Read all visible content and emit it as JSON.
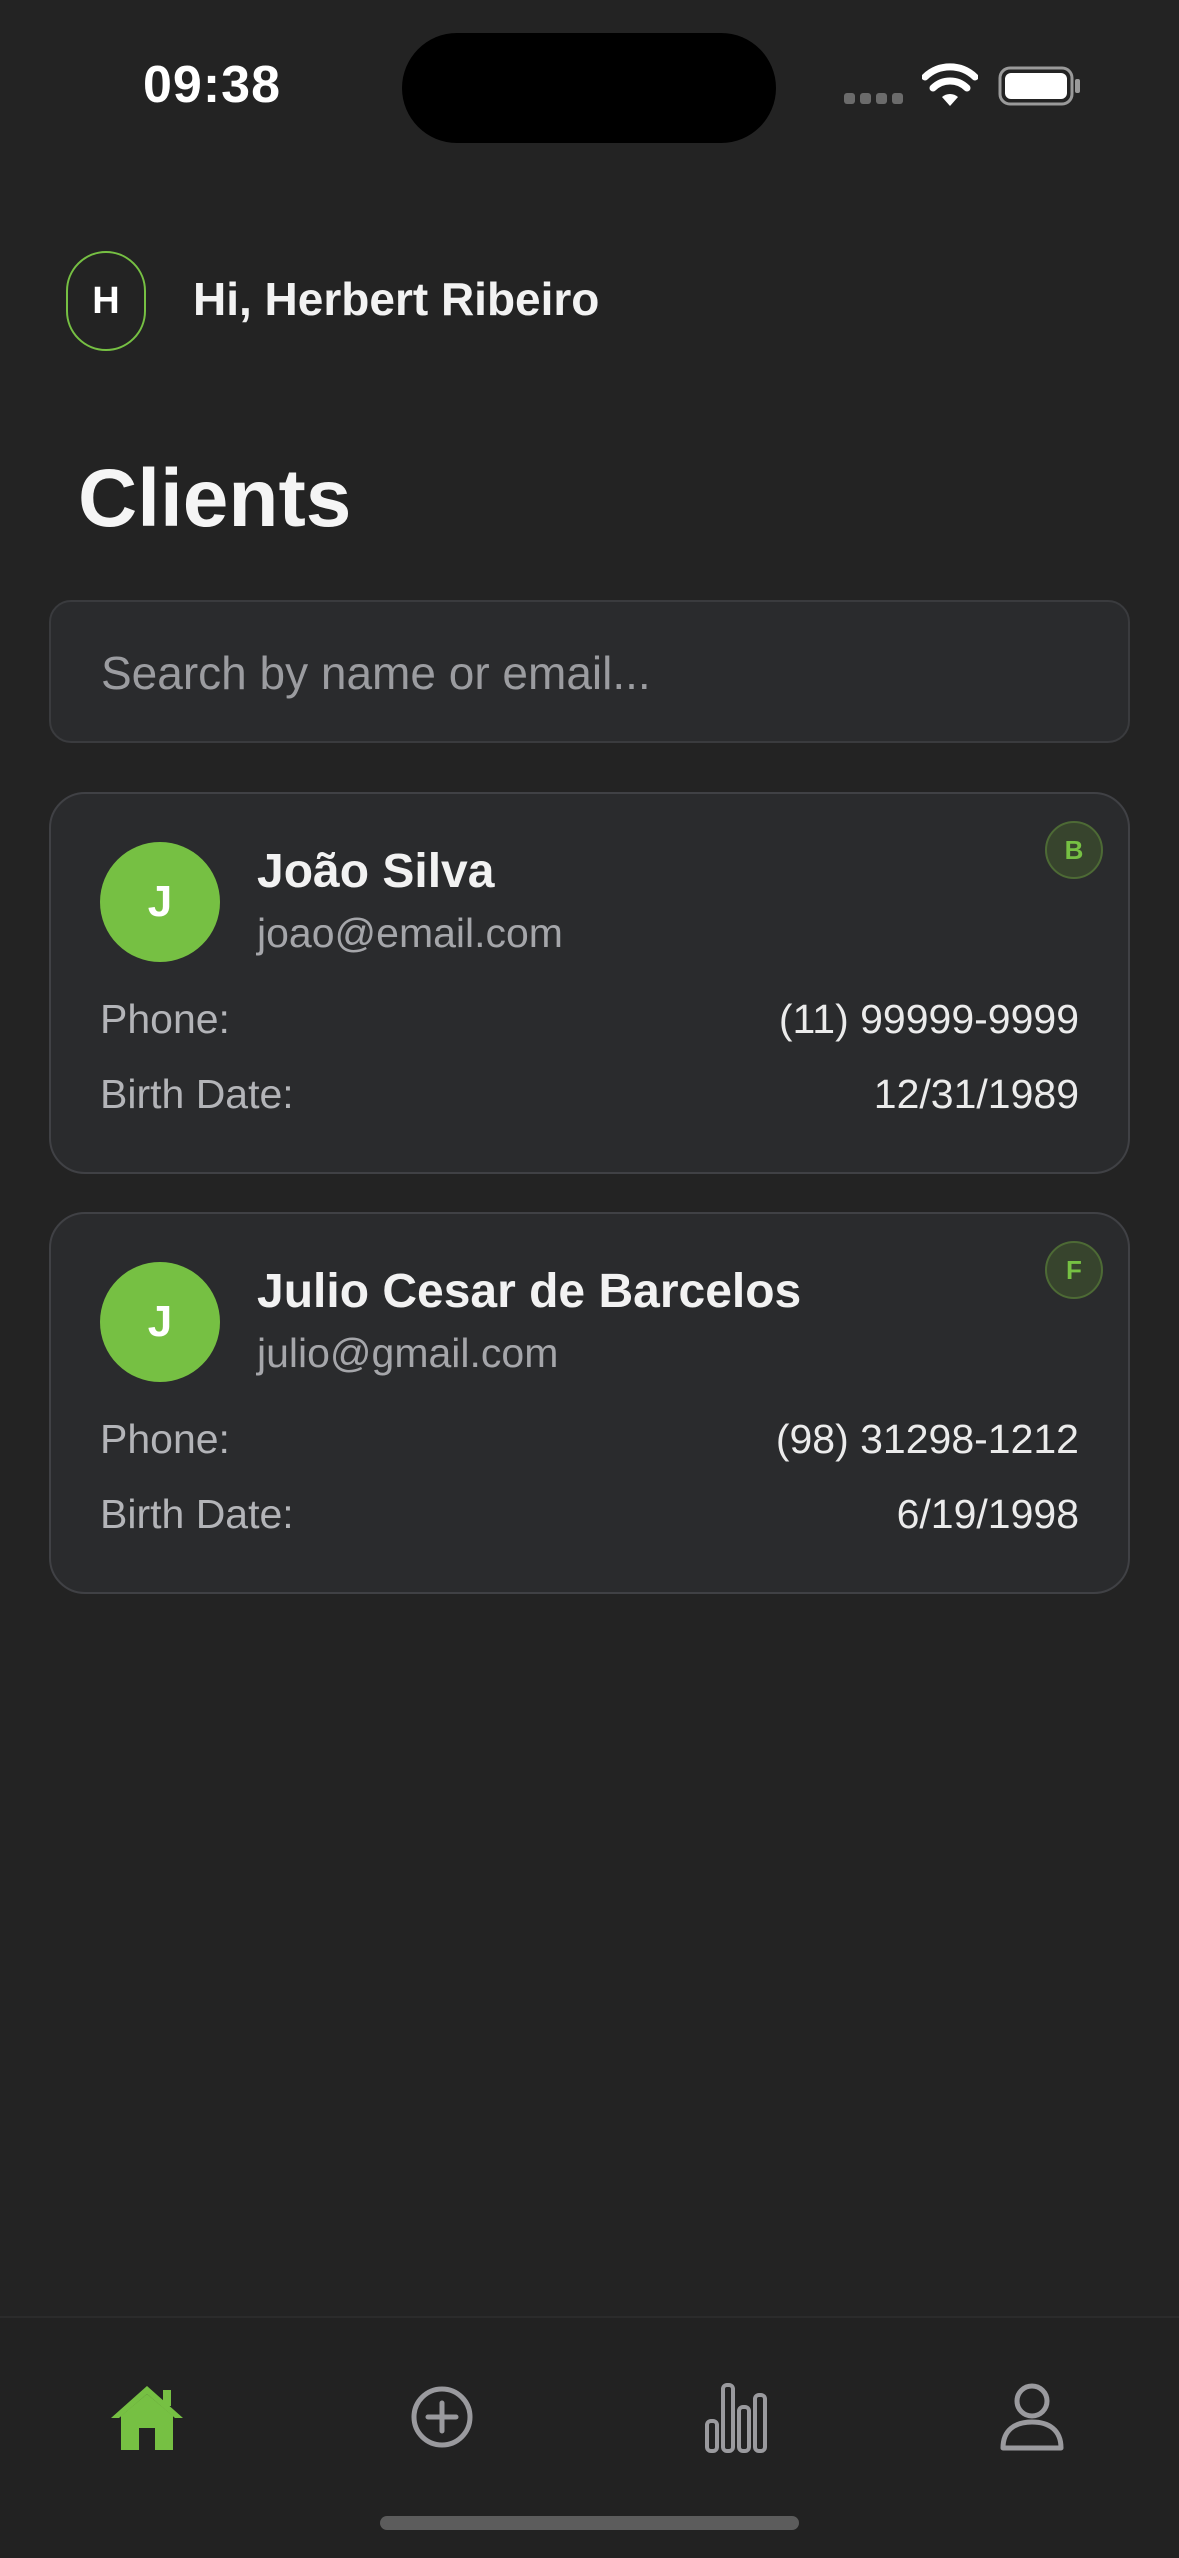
{
  "status_bar": {
    "time": "09:38"
  },
  "header": {
    "avatar_initial": "H",
    "greeting": "Hi, Herbert Ribeiro"
  },
  "page": {
    "title": "Clients"
  },
  "search": {
    "placeholder": "Search by name or email..."
  },
  "labels": {
    "phone": "Phone:",
    "birth_date": "Birth Date:"
  },
  "clients": [
    {
      "initial": "J",
      "name": "João Silva",
      "email": "joao@email.com",
      "badge": "B",
      "phone": "(11) 99999-9999",
      "birth_date": "12/31/1989"
    },
    {
      "initial": "J",
      "name": "Julio Cesar de Barcelos",
      "email": "julio@gmail.com",
      "badge": "F",
      "phone": "(98) 31298-1212",
      "birth_date": "6/19/1998"
    }
  ],
  "tab_bar": {
    "items": [
      {
        "icon": "home-icon",
        "active": true
      },
      {
        "icon": "plus-circle-icon",
        "active": false
      },
      {
        "icon": "bar-chart-icon",
        "active": false
      },
      {
        "icon": "user-icon",
        "active": false
      }
    ]
  },
  "colors": {
    "background": "#232323",
    "card": "#2a2b2d",
    "accent": "#76c043",
    "muted_text": "#a5a6aa",
    "inactive_icon": "#9a9a9e"
  }
}
